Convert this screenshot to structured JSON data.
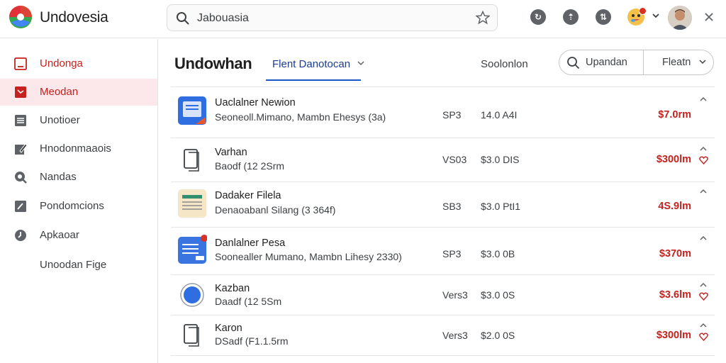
{
  "app": {
    "title": "Undovesia"
  },
  "search": {
    "value": "Jabouasia"
  },
  "sidebar": {
    "items": [
      {
        "label": "Undonga",
        "icon": "document-icon"
      },
      {
        "label": "Meodan",
        "icon": "inbox-icon"
      },
      {
        "label": "Unotioer",
        "icon": "list-icon"
      },
      {
        "label": "Hnodonmaaois",
        "icon": "edit-icon"
      },
      {
        "label": "Nandas",
        "icon": "search-doc-icon"
      },
      {
        "label": "Pondomcions",
        "icon": "pen-icon"
      },
      {
        "label": "Apkaoar",
        "icon": "clock-icon"
      },
      {
        "label": "Unoodan Fige",
        "icon": ""
      }
    ]
  },
  "main": {
    "title": "Undowhan",
    "filter_tab": "Flent Danotocan",
    "column_label": "Soolonlon",
    "search_button": "Upandan",
    "filter_button": "Fleatn"
  },
  "rows": [
    {
      "name": "Uaclalner Newion",
      "sub": "Seoneoll.Mimano, Mambn Ehesys (3a)",
      "col1": "SP3",
      "col2": "14.0 A4I",
      "price": "$7.0rm",
      "thumb": "blue-doc-icon",
      "fav": false
    },
    {
      "name": "Varhan",
      "sub": "Baodf (12 2Srm",
      "col1": "VS03",
      "col2": "$3.0 DIS",
      "price": "$300lm",
      "thumb": "outline-doc-icon",
      "fav": true
    },
    {
      "name": "Dadaker Filela",
      "sub": "Denaoabanl Silang (3 364f)",
      "col1": "SB3",
      "col2": "$3.0 PtI1",
      "price": "4S.9lm",
      "thumb": "spreadsheet-icon",
      "fav": false
    },
    {
      "name": "Danlalner Pesa",
      "sub": "Soonealler Mumano, Mambn Lihesy 2330)",
      "col1": "SP3",
      "col2": "$3.0 0B",
      "price": "$370m",
      "thumb": "blue-form-icon",
      "fav": false
    },
    {
      "name": "Kazban",
      "sub": "Daadf (12 5Sm",
      "col1": "Vers3",
      "col2": "$3.0 0S",
      "price": "$3.6lm",
      "thumb": "blue-circle-icon",
      "fav": true
    },
    {
      "name": "Karon",
      "sub": "DSadf (F1.1.5rm",
      "col1": "Vers3",
      "col2": "$2.0 0S",
      "price": "$300lm",
      "thumb": "outline-doc-icon",
      "fav": true
    }
  ]
}
